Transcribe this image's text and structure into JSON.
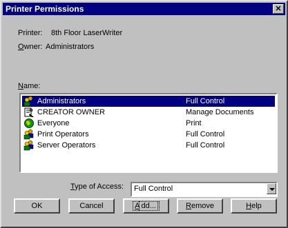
{
  "window": {
    "title": "Printer Permissions",
    "close_symbol": "✕"
  },
  "info": {
    "printer_label": "Printer:",
    "printer_value": "8th Floor LaserWriter",
    "owner_label_first": "O",
    "owner_label_rest": "wner:",
    "owner_value": "Administrators"
  },
  "list": {
    "label_first": "N",
    "label_rest": "ame:",
    "items": [
      {
        "name": "Administrators",
        "permission": "Full Control",
        "icon": "group-icon",
        "selected": true
      },
      {
        "name": "CREATOR OWNER",
        "permission": "Manage Documents",
        "icon": "creator-owner-icon",
        "selected": false
      },
      {
        "name": "Everyone",
        "permission": "Print",
        "icon": "globe-icon",
        "selected": false
      },
      {
        "name": "Print Operators",
        "permission": "Full Control",
        "icon": "group-icon",
        "selected": false
      },
      {
        "name": "Server Operators",
        "permission": "Full Control",
        "icon": "group-icon",
        "selected": false
      }
    ]
  },
  "access": {
    "label_first": "T",
    "label_rest": "ype of Access:",
    "value": "Full Control"
  },
  "buttons": {
    "ok": "OK",
    "cancel": "Cancel",
    "add_first": "A",
    "add_rest": "dd...",
    "remove_first": "R",
    "remove_rest": "emove",
    "help_first": "H",
    "help_rest": "elp"
  },
  "colors": {
    "title_bar": "#000080",
    "face": "#c0c0c0",
    "selection": "#000080"
  }
}
